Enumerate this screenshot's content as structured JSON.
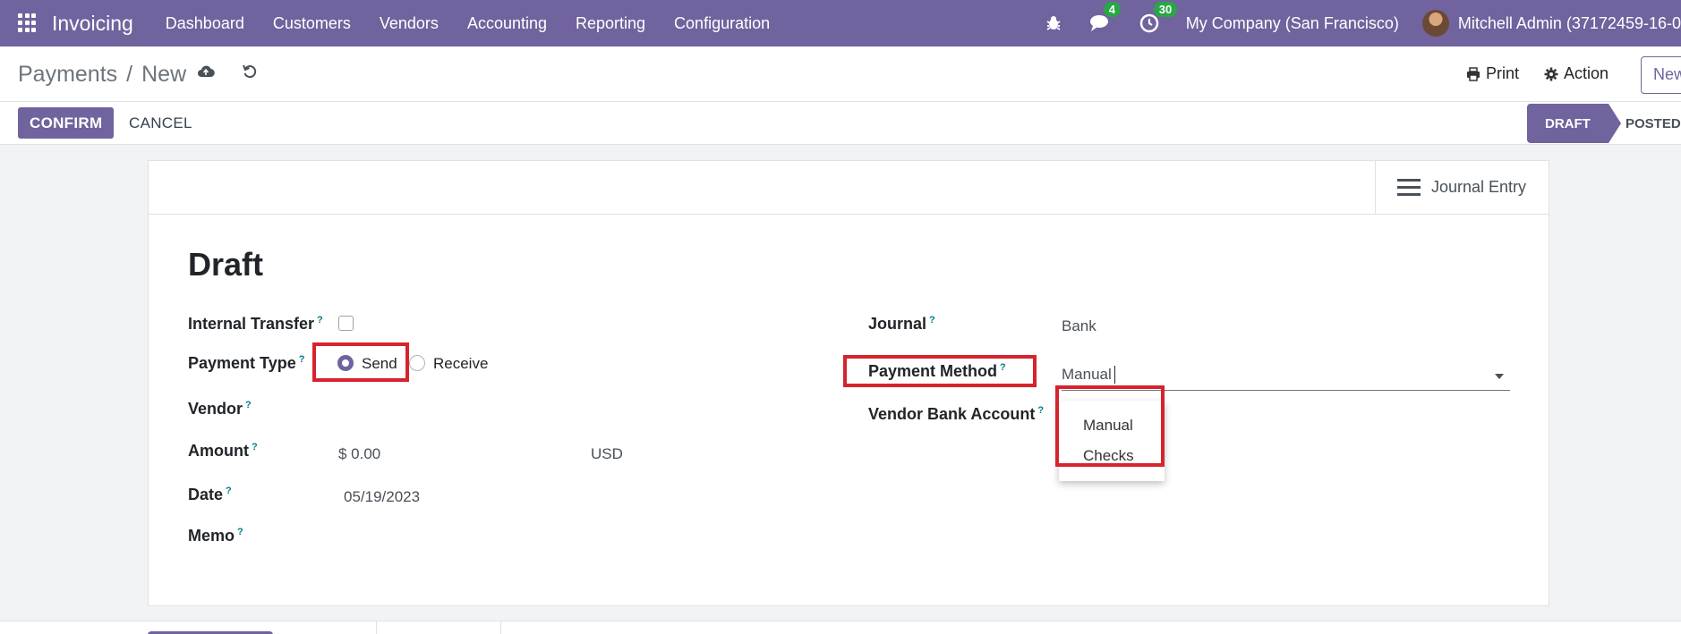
{
  "navbar": {
    "app_name": "Invoicing",
    "menu": [
      "Dashboard",
      "Customers",
      "Vendors",
      "Accounting",
      "Reporting",
      "Configuration"
    ],
    "messages_count": "4",
    "activities_count": "30",
    "company": "My Company (San Francisco)",
    "user": "Mitchell Admin (37172459-16-0"
  },
  "breadcrumb": {
    "parent": "Payments",
    "separator": "/",
    "current": "New"
  },
  "actions": {
    "print": "Print",
    "action": "Action",
    "new": "New"
  },
  "control": {
    "confirm": "CONFIRM",
    "cancel": "CANCEL",
    "status_draft": "DRAFT",
    "status_posted": "POSTED"
  },
  "sheet": {
    "journal_entry": "Journal Entry",
    "title": "Draft",
    "help_mark": "?",
    "left": {
      "internal_transfer_label": "Internal Transfer",
      "payment_type_label": "Payment Type",
      "payment_type_options": [
        "Send",
        "Receive"
      ],
      "payment_type_selected": "Send",
      "vendor_label": "Vendor",
      "amount_label": "Amount",
      "amount_value": "$ 0.00",
      "currency": "USD",
      "date_label": "Date",
      "date_value": "05/19/2023",
      "memo_label": "Memo"
    },
    "right": {
      "journal_label": "Journal",
      "journal_value": "Bank",
      "payment_method_label": "Payment Method",
      "payment_method_value": "Manual",
      "vendor_bank_account_label": "Vendor Bank Account",
      "payment_method_options": [
        "Manual",
        "Checks"
      ]
    }
  },
  "colors": {
    "brand": "#71639e",
    "highlight": "#d7232d",
    "badge": "#28a745",
    "help": "#017e84"
  }
}
